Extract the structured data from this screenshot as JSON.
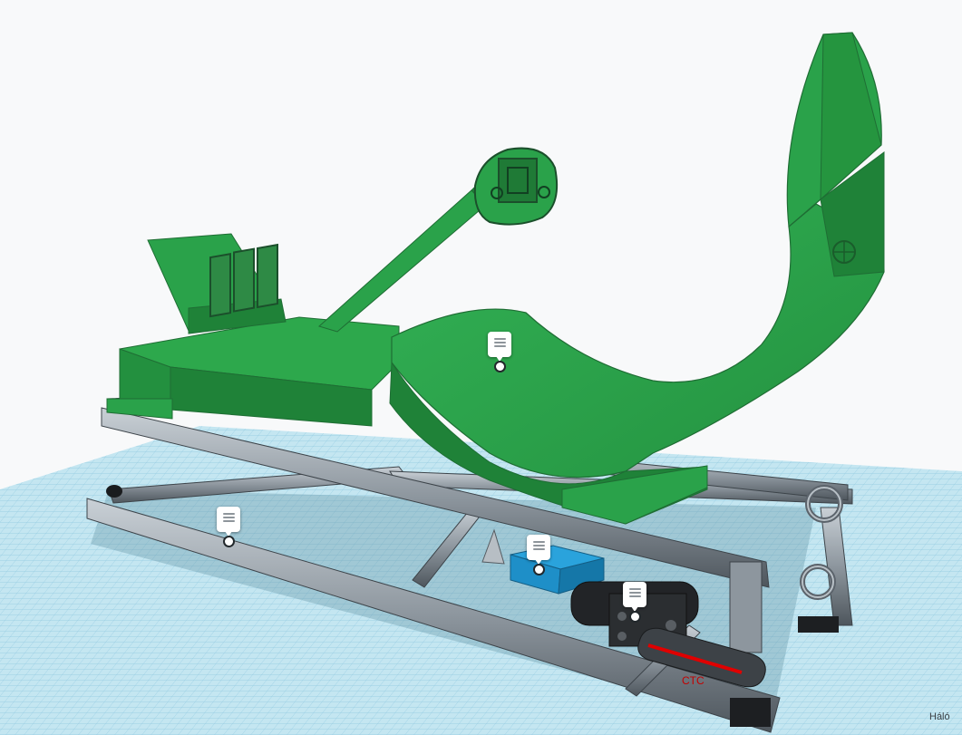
{
  "workplane": {
    "grid_unit_label": "Háló"
  },
  "model": {
    "dimension_label": "CTC",
    "colors": {
      "body_green": "#2aa24a",
      "body_green_dark": "#1c7a34",
      "frame_gray": "#9aa3ab",
      "frame_gray_dark": "#5b636b",
      "block_blue": "#1e8fc8",
      "motor_black": "#222427",
      "accent_red": "#e00000",
      "grid_blue": "#b4dcea"
    },
    "notes": [
      {
        "name": "note-seat"
      },
      {
        "name": "note-frame"
      },
      {
        "name": "note-block"
      },
      {
        "name": "note-motor"
      }
    ]
  }
}
